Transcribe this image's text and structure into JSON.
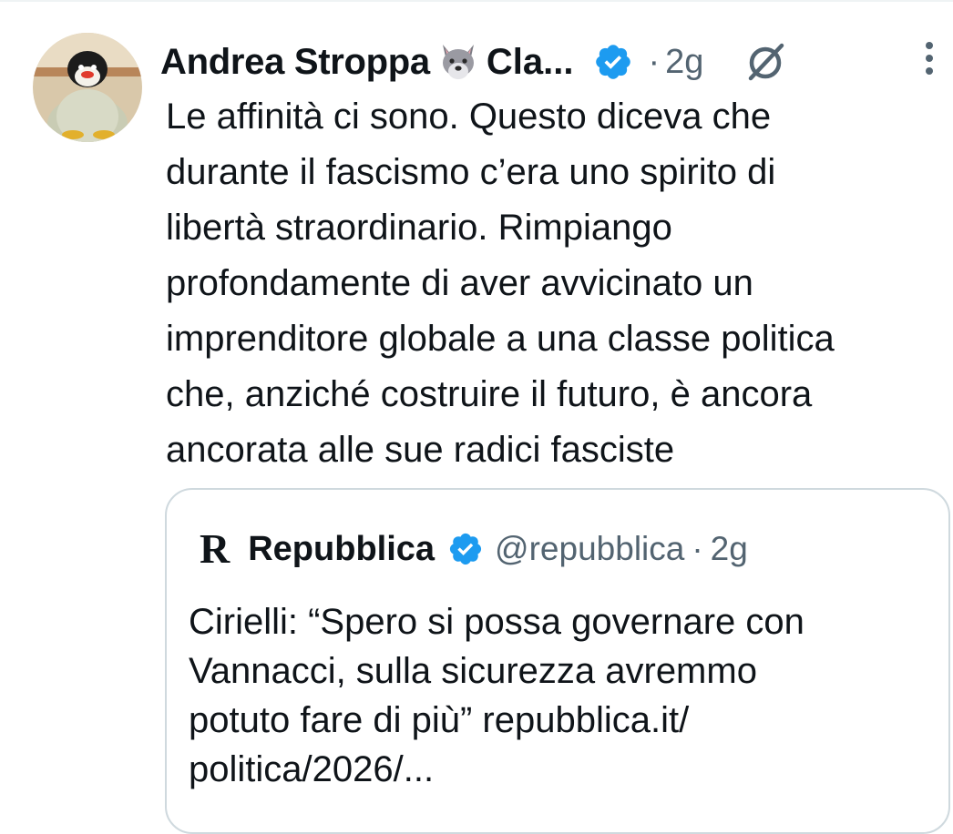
{
  "tweet": {
    "display_name": "Andrea Stroppa",
    "name_emoji_icon": "wolf-face-icon",
    "name_tail": "Cla...",
    "verified_icon": "verified-badge-icon",
    "separator": "·",
    "time": "2g",
    "grok_icon": "grok-icon",
    "more_icon": "more-vertical-icon",
    "text": "Le affinità ci sono. Questo diceva che\ndurante il fascismo c’era uno spirito di\nlibertà straordinario. Rimpiango\nprofondamente di aver avvicinato un\nimprenditore globale a una classe politica\nche, anziché costruire il futuro, è ancora\nancorata alle sue radici fasciste"
  },
  "quote": {
    "logo": "R",
    "name": "Repubblica",
    "handle": "@repubblica",
    "separator": "·",
    "time": "2g",
    "text": "Cirielli: “Spero si possa governare con\nVannacci, sulla sicurezza avremmo\npotuto fare di più” repubblica.it/\npolitica/2026/..."
  },
  "colors": {
    "verified_blue": "#1d9bf0",
    "secondary_text": "#536471",
    "primary_text": "#0f1419",
    "border": "#cfd9de"
  }
}
